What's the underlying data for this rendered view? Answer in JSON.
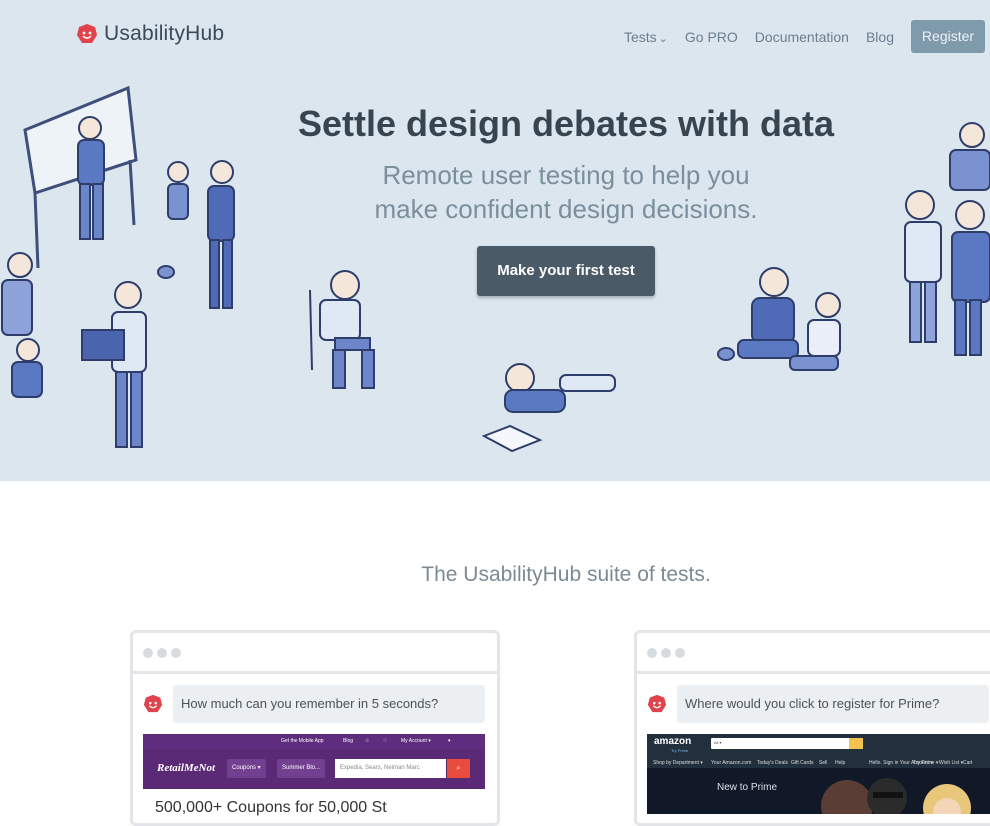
{
  "nav": {
    "brand": "UsabilityHub",
    "links": [
      "Tests",
      "Go PRO",
      "Documentation",
      "Blog"
    ],
    "tests_caret": "⌄",
    "register": "Register"
  },
  "hero": {
    "headline": "Settle design debates with data",
    "subhead_line1": "Remote user testing to help you",
    "subhead_line2": "make confident design decisions.",
    "cta": "Make your first test"
  },
  "suite": {
    "title": "The UsabilityHub suite of tests."
  },
  "cards": [
    {
      "question": "How much can you remember in 5 seconds?",
      "site": {
        "top_links": [
          "Get the Mobile App",
          "Blog",
          "☆",
          "♡",
          "My Account ▾",
          "▾"
        ],
        "logo": "RetailMeNot",
        "buttons": [
          "Coupons ▾",
          "Summer Blo..."
        ],
        "search_placeholder": "Expedia, Sears, Neiman Marc",
        "search_icon": "search-icon",
        "stat_line": "500,000+ Coupons for 50,000 St"
      }
    },
    {
      "question": "Where would you click to register for Prime?",
      "site": {
        "logo": "amazon",
        "logo_sub": "Try Prime",
        "search_label": "All ▾",
        "nav_links": [
          "Shop by Department ▾",
          "Your Amazon.com",
          "Today's Deals",
          "Gift Cards",
          "Sell",
          "Help",
          "Hello. Sign in Your Account ▾",
          "Try Prime ▾",
          "Wish List ▾",
          "Cart"
        ],
        "banner": "New to Prime"
      }
    }
  ],
  "colors": {
    "hero_bg": "#dce6ee",
    "cta_bg": "#4b5a67",
    "register_bg": "#7f9aab",
    "brand_red": "#e0434b",
    "illustration_blue": "#5b78c2"
  }
}
